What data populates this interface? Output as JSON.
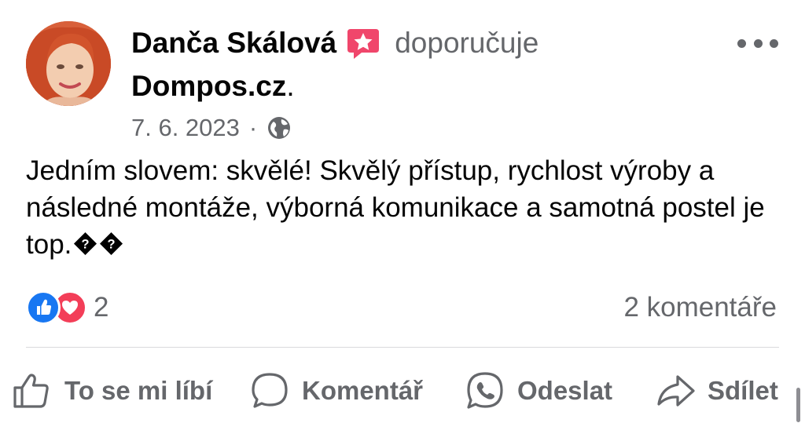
{
  "post": {
    "author": "Danča Skálová",
    "verb": "doporučuje",
    "page_name": "Dompos.cz",
    "period": ".",
    "date": "7. 6. 2023",
    "separator": "·",
    "body": "Jedním slovem: skvělé! Skvělý přístup, rychlost výroby a následné montáže, výborná komunikace a samotná postel je top.",
    "reaction_count": "2",
    "comments": "2 komentáře"
  },
  "actions": {
    "like": "To se mi líbí",
    "comment": "Komentář",
    "send": "Odeslat",
    "share": "Sdílet"
  },
  "icons": {
    "recommend_badge": "star-badge-icon",
    "audience": "globe-icon",
    "more": "more-options-icon",
    "reactions": [
      "like-reaction-icon",
      "love-reaction-icon"
    ],
    "unknown_glyphs": [
      "question-diamond-icon",
      "question-diamond-icon"
    ]
  },
  "colors": {
    "text": "#050505",
    "secondary": "#65676b",
    "like_blue": "#1877f2",
    "love_red": "#f33e58",
    "recommend_pink": "#f0466b"
  }
}
